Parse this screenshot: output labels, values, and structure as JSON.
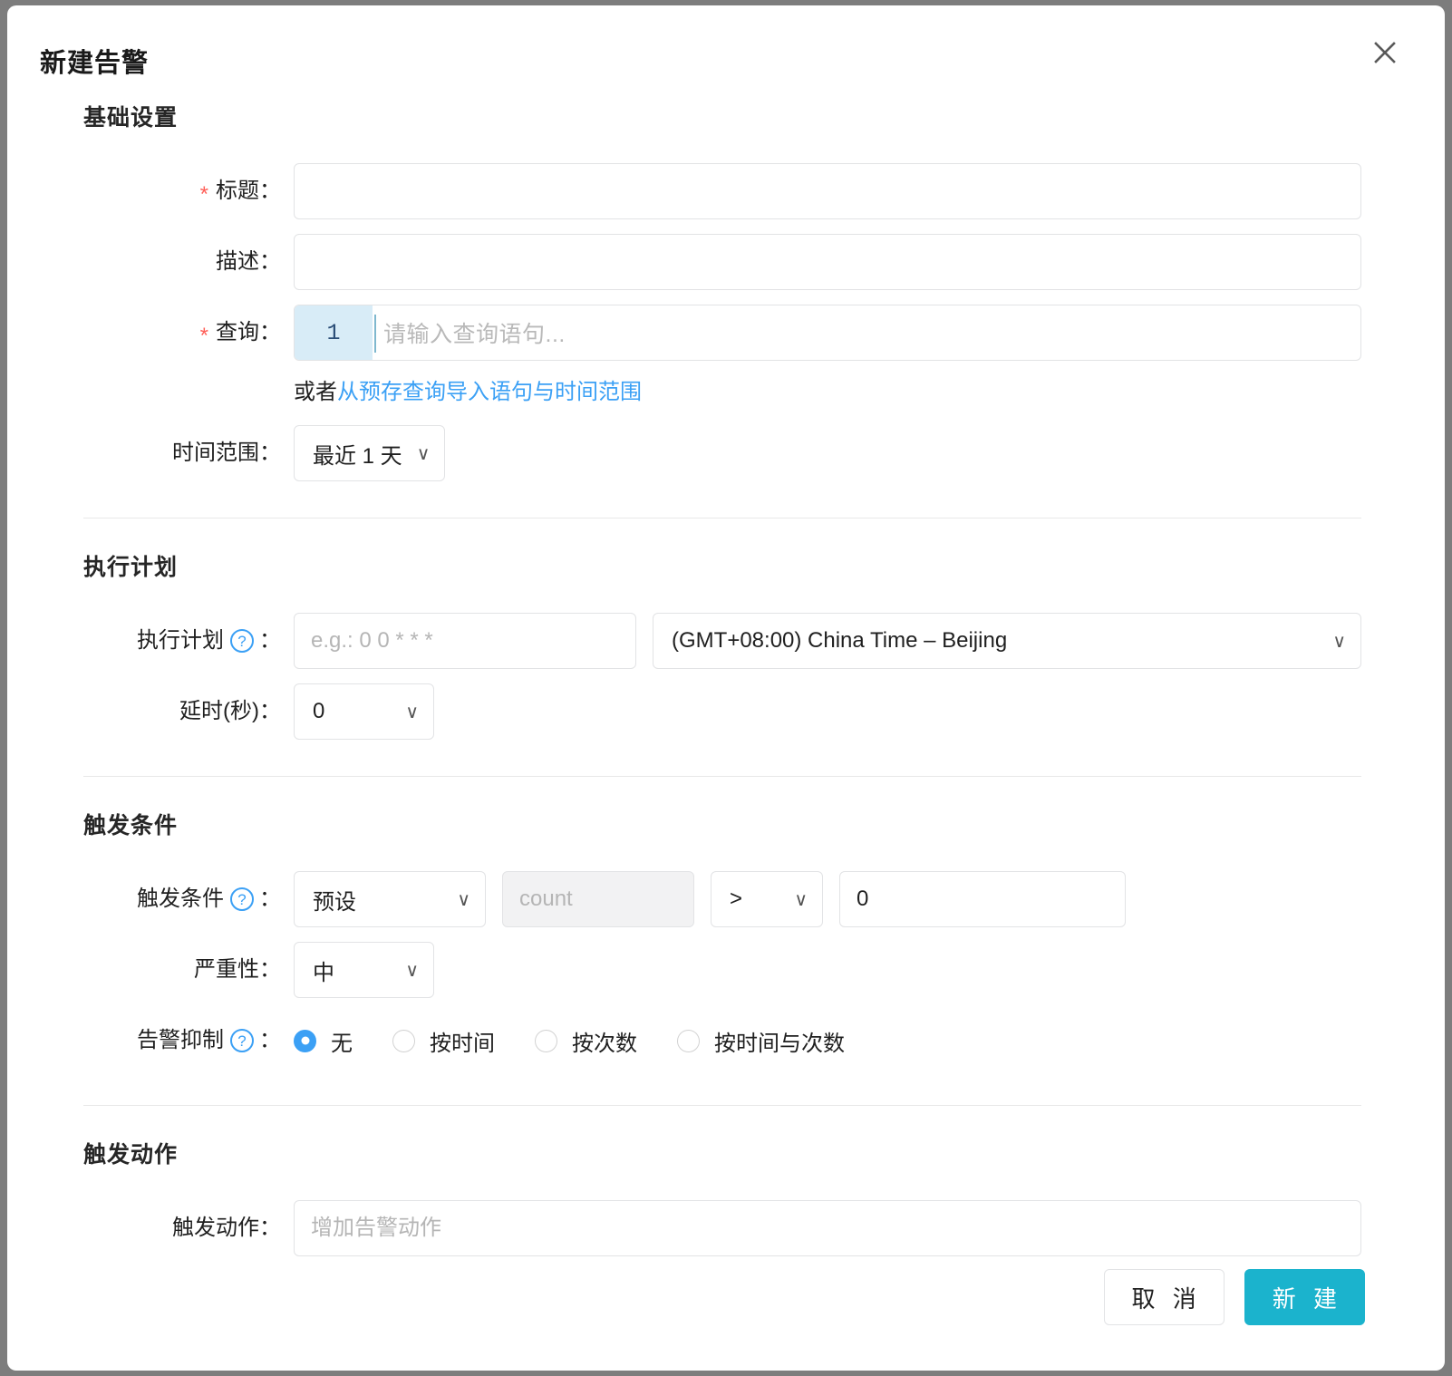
{
  "dialog": {
    "title": "新建告警",
    "close_icon": "close-icon"
  },
  "sections": {
    "basic": {
      "heading": "基础设置",
      "title_field": {
        "label": "标题：",
        "required_mark": "*",
        "value": "",
        "placeholder": ""
      },
      "desc_field": {
        "label": "描述：",
        "value": "",
        "placeholder": ""
      },
      "query_field": {
        "label": "查询：",
        "required_mark": "*",
        "line_number": "1",
        "placeholder": "请输入查询语句..."
      },
      "import_hint": {
        "prefix": "或者",
        "link": "从预存查询导入语句与时间范围"
      },
      "time_range": {
        "label": "时间范围：",
        "value": "最近 1 天",
        "chevron": "chevron-down-icon"
      }
    },
    "schedule": {
      "heading": "执行计划",
      "cron_field": {
        "label": "执行计划",
        "help": "?",
        "colon": "：",
        "value": "",
        "placeholder": "e.g.: 0 0 * * *"
      },
      "timezone": {
        "value": "(GMT+08:00) China Time – Beijing",
        "chevron": "chevron-down-icon"
      },
      "delay": {
        "label": "延时(秒)：",
        "value": "0",
        "chevron": "chevron-down-icon"
      }
    },
    "trigger": {
      "heading": "触发条件",
      "condition": {
        "label": "触发条件",
        "help": "?",
        "colon": "：",
        "mode": "预设",
        "metric_placeholder": "count",
        "metric_value": "",
        "operator": ">",
        "threshold": "0"
      },
      "severity": {
        "label": "严重性：",
        "value": "中"
      },
      "suppression": {
        "label": "告警抑制",
        "help": "?",
        "colon": "：",
        "selected": "无",
        "options": [
          {
            "label": "无",
            "checked": true
          },
          {
            "label": "按时间",
            "checked": false
          },
          {
            "label": "按次数",
            "checked": false
          },
          {
            "label": "按时间与次数",
            "checked": false
          }
        ]
      }
    },
    "actions": {
      "heading": "触发动作",
      "field": {
        "label": "触发动作：",
        "value": "",
        "placeholder": "增加告警动作"
      }
    }
  },
  "footer": {
    "cancel_label": "取 消",
    "submit_label": "新 建"
  },
  "colors": {
    "primary": "#1bb3cd",
    "link": "#3ba0f5",
    "required": "#ff5f58",
    "gutter_bg": "#d8ecf7"
  }
}
